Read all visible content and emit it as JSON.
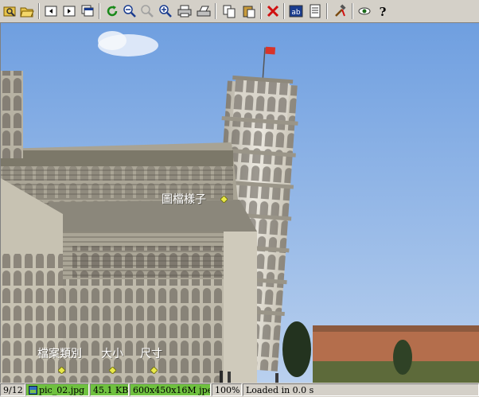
{
  "toolbar": {
    "buttons": [
      {
        "name": "open-folder-icon"
      },
      {
        "name": "open-file-icon"
      },
      {
        "name": "prev-file-icon"
      },
      {
        "name": "next-file-icon"
      },
      {
        "name": "fullscreen-icon"
      },
      {
        "name": "refresh-icon"
      },
      {
        "name": "zoom-out-icon"
      },
      {
        "name": "zoom-disabled-icon"
      },
      {
        "name": "zoom-in-icon"
      },
      {
        "name": "print-icon"
      },
      {
        "name": "scan-icon"
      },
      {
        "name": "copy-icon"
      },
      {
        "name": "paste-icon"
      },
      {
        "name": "delete-icon"
      },
      {
        "name": "text-icon"
      },
      {
        "name": "properties-icon"
      },
      {
        "name": "tools-icon"
      },
      {
        "name": "view-eye-icon"
      },
      {
        "name": "help-icon"
      }
    ]
  },
  "annotations": {
    "image_appearance": "圖檔樣子",
    "file_type": "檔案類別",
    "size": "大小",
    "dimensions": "尺寸"
  },
  "statusbar": {
    "index": "9/12",
    "filename": "pic_02.jpg",
    "filesize": "45.1 KB",
    "format": "600x450x16M jpeg",
    "zoom": "100%",
    "load_time": "Loaded in 0.0 s"
  },
  "colors": {
    "highlight": "#6fc13f",
    "annotation_pin": "#e8e84a",
    "sky": "#7aa6e2"
  }
}
